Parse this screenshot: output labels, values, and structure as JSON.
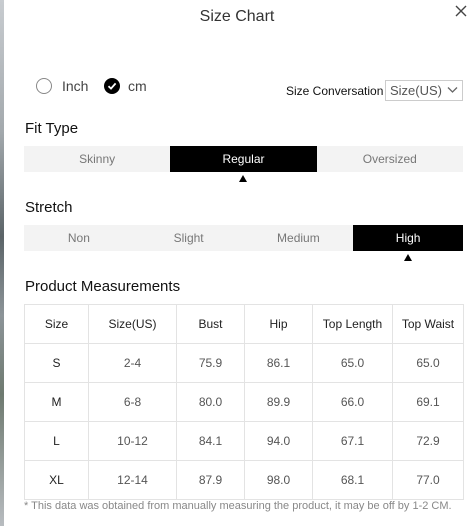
{
  "header": {
    "title": "Size Chart"
  },
  "units": {
    "options": [
      {
        "label": "Inch",
        "selected": false
      },
      {
        "label": "cm",
        "selected": true
      }
    ]
  },
  "size_conversion": {
    "label": "Size Conversation",
    "value": "Size(US)"
  },
  "fit_type": {
    "title": "Fit Type",
    "options": [
      "Skinny",
      "Regular",
      "Oversized"
    ],
    "selected": "Regular"
  },
  "stretch": {
    "title": "Stretch",
    "options": [
      "Non",
      "Slight",
      "Medium",
      "High"
    ],
    "selected": "High"
  },
  "measurements": {
    "title": "Product Measurements",
    "columns": [
      "Size",
      "Size(US)",
      "Bust",
      "Hip",
      "Top Length",
      "Top Waist"
    ],
    "rows": [
      [
        "S",
        "2-4",
        "75.9",
        "86.1",
        "65.0",
        "65.0"
      ],
      [
        "M",
        "6-8",
        "80.0",
        "89.9",
        "66.0",
        "69.1"
      ],
      [
        "L",
        "10-12",
        "84.1",
        "94.0",
        "67.1",
        "72.9"
      ],
      [
        "XL",
        "12-14",
        "87.9",
        "98.0",
        "68.1",
        "77.0"
      ]
    ]
  },
  "footnote": "* This data was obtained from manually measuring the product, it may be off by 1-2 CM.",
  "icons": {
    "close": "close-icon",
    "radio_checked": "check-icon",
    "select": "chevron-down-icon"
  }
}
